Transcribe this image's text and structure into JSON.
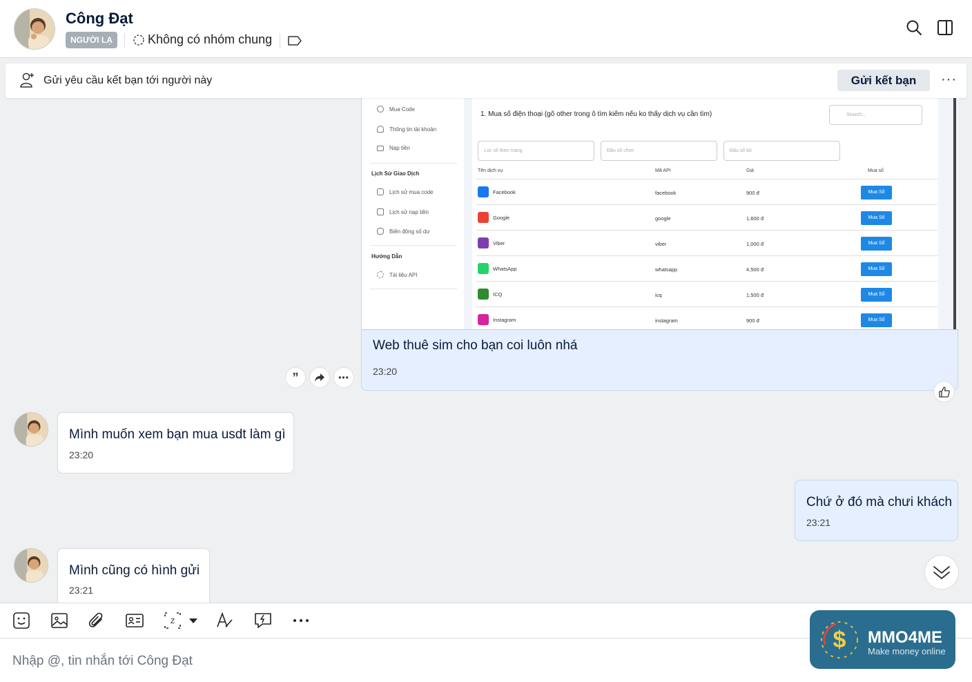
{
  "header": {
    "name": "Công Đạt",
    "badge": "NGƯỜI LẠ",
    "common_groups": "Không có nhóm chung"
  },
  "friend_bar": {
    "text": "Gửi yêu cầu kết bạn tới người này",
    "button": "Gửi kết bạn",
    "more": "···"
  },
  "image_message": {
    "screenshot": {
      "sidebar": {
        "items_top": [
          "Mua Code",
          "Thông tin tài khoản",
          "Nạp tiền"
        ],
        "section1": "Lịch Sử Giao Dịch",
        "items_mid": [
          "Lịch sử mua code",
          "Lịch sử nạp tiền",
          "Biến động số dư"
        ],
        "section2": "Hướng Dẫn",
        "items_bottom": [
          "Tài liệu API"
        ]
      },
      "title": "1. Mua số điện thoại (gõ other trong ô tìm kiếm nếu ko thấy dịch vụ cần tìm)",
      "search_placeholder": "Search...",
      "filter_network": "Lọc số theo mạng",
      "filter_prefix": "Đầu số chọn",
      "filter_exclude": "Đầu số bỏ",
      "columns": [
        "Tên dịch vụ",
        "Mã API",
        "Giá",
        "Mua số"
      ],
      "rows": [
        {
          "service": "Facebook",
          "api": "facebook",
          "price": "900 đ",
          "button": "Mua Số",
          "color": "#1877f2"
        },
        {
          "service": "Google",
          "api": "google",
          "price": "1,600 đ",
          "button": "Mua Số",
          "color": "#ea4335"
        },
        {
          "service": "Viber",
          "api": "viber",
          "price": "1,000 đ",
          "button": "Mua Số",
          "color": "#7d3daf"
        },
        {
          "service": "WhatsApp",
          "api": "whatsapp",
          "price": "4,500 đ",
          "button": "Mua Số",
          "color": "#25d366"
        },
        {
          "service": "ICQ",
          "api": "icq",
          "price": "1,500 đ",
          "button": "Mua Số",
          "color": "#2e8b2e"
        },
        {
          "service": "Instagram",
          "api": "instagram",
          "price": "900 đ",
          "button": "Mua Số",
          "color": "#d6249f"
        }
      ]
    },
    "caption": "Web thuê sim cho bạn coi luôn nhá",
    "time": "23:20"
  },
  "messages": [
    {
      "text": "Mình muốn xem bạn mua usdt làm gì",
      "time": "23:20"
    },
    {
      "text": "Chứ ở đó mà chưi khách",
      "time": "23:21"
    },
    {
      "text": "Mình cũng có hình gửi",
      "time": "23:21"
    }
  ],
  "composer": {
    "placeholder": "Nhập @, tin nhắn tới Công Đạt"
  },
  "watermark": {
    "brand": "MMO4ME",
    "slogan": "Make money online"
  },
  "colors": {
    "my_bubble": "#e5efff",
    "buy_button": "#1e88e5",
    "background": "#eef0f1"
  }
}
